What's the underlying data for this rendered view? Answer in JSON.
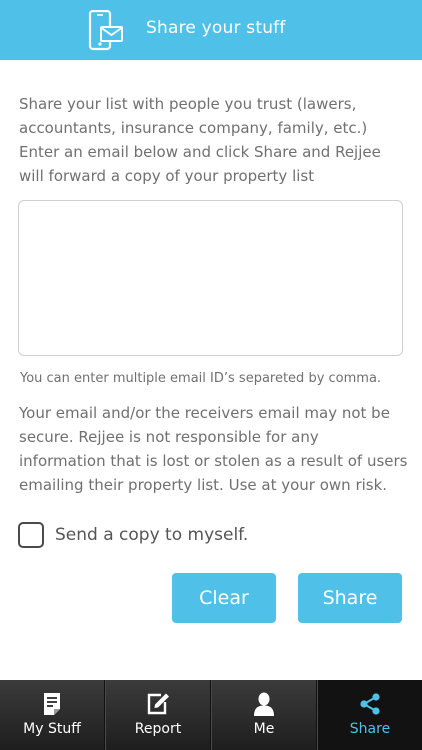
{
  "header": {
    "title": "Share your stuff",
    "icon": "phone-mail-icon"
  },
  "main": {
    "intro": "Share your list with people you trust (lawers, accountants, insurance company, family, etc.) Enter an email below and click Share and Rejjee will forward a copy of your property list",
    "email_value": "",
    "hint": "You can enter multiple email ID’s separeted by comma.",
    "warning": "Your email and/or the receivers email may not be secure. Rejjee is not responsible for any information that is lost or stolen as a result of users emailing their property list. Use at your own risk.",
    "copy_label": "Send a copy to myself.",
    "copy_checked": false,
    "clear_label": "Clear",
    "share_label": "Share"
  },
  "tabbar": {
    "items": [
      {
        "label": "My Stuff",
        "icon": "document-list-icon",
        "active": false
      },
      {
        "label": "Report",
        "icon": "edit-icon",
        "active": false
      },
      {
        "label": "Me",
        "icon": "user-icon",
        "active": false
      },
      {
        "label": "Share",
        "icon": "share-icon",
        "active": true
      }
    ]
  },
  "colors": {
    "accent": "#4fc1e9",
    "tabbar_bg": "#2a2a2a",
    "text": "#707070"
  }
}
